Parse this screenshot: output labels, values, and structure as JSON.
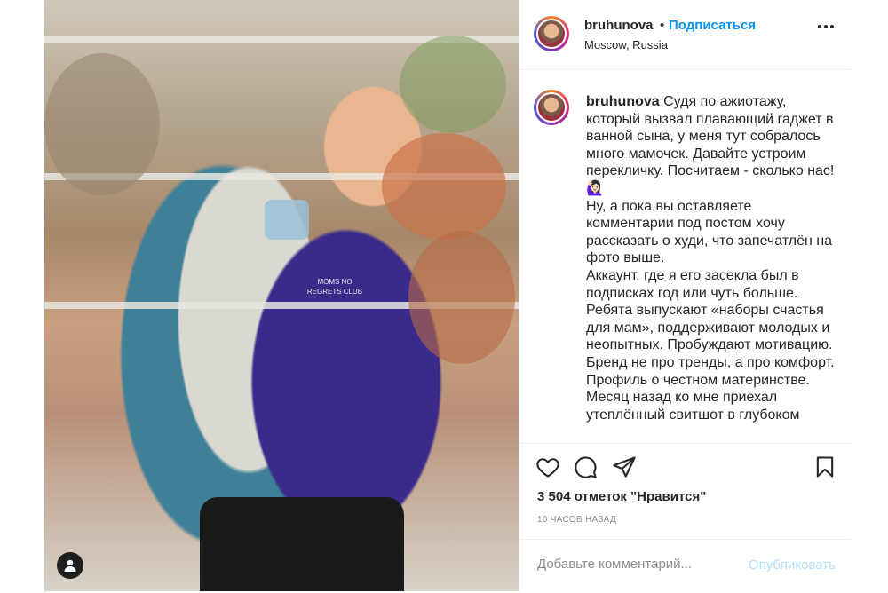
{
  "post": {
    "username": "bruhunova",
    "follow_label": "Подписаться",
    "location": "Moscow, Russia",
    "more_icon": "more-horizontal-icon"
  },
  "caption": {
    "username": "bruhunova",
    "lines": [
      "Судя по ажиотажу, который вызвал плавающий гаджет в ванной сына, у меня тут собралось много мамочек. Давайте устроим перекличку. Посчитаем - сколько нас! 🙋🏻‍♀️",
      "Ну, а пока вы оставляете комментарии под постом хочу рассказать о худи, что запечатлён на фото выше.",
      "Аккаунт, где я его засекла был в подписках год или чуть больше.",
      "Ребята выпускают «наборы счастья для мам», поддерживают молодых и неопытных. Пробуждают мотивацию. Бренд не про тренды, а про комфорт. Профиль о честном материнстве.",
      "Месяц назад ко мне приехал утеплённый свитшот в глубоком"
    ]
  },
  "photo": {
    "hoodie_text": "MOMS NO REGRETS CLUB"
  },
  "actions": {
    "likes_text": "3 504 отметок \"Нравится\"",
    "time_text": "10 ЧАСОВ НАЗАД"
  },
  "comment": {
    "placeholder": "Добавьте комментарий...",
    "post_label": "Опубликовать"
  },
  "colors": {
    "accent": "#0095f6",
    "post_disabled": "#b2dffc"
  }
}
